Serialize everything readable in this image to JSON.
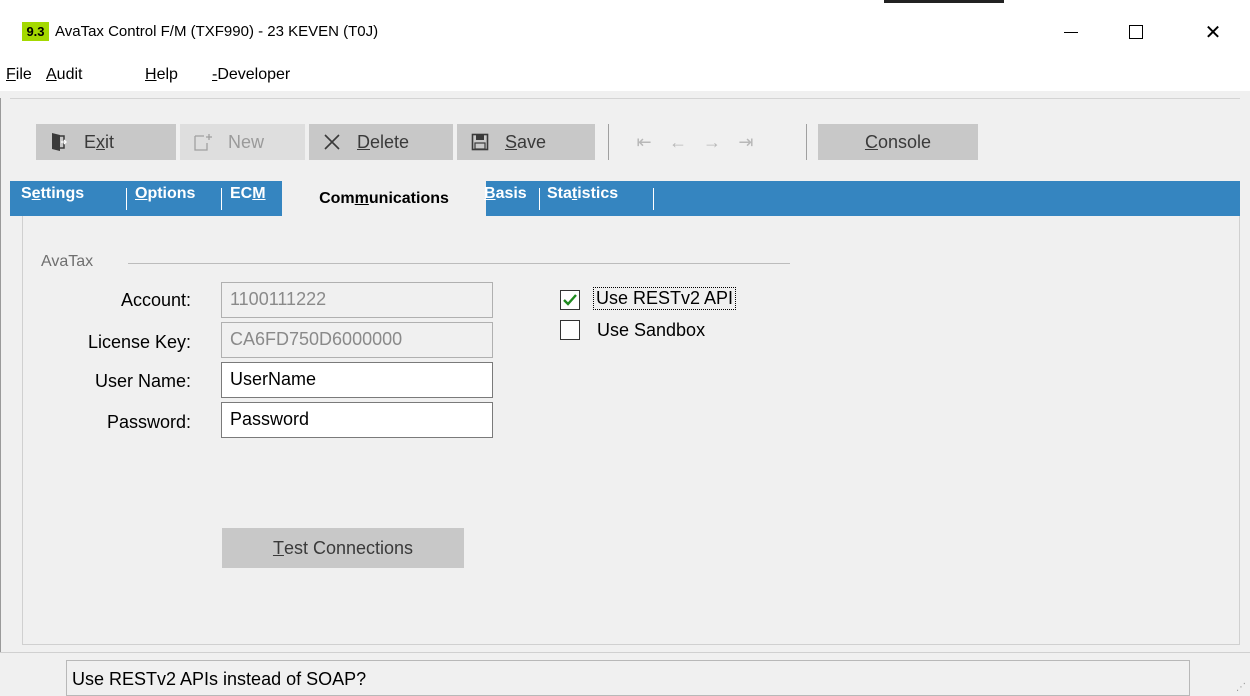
{
  "window": {
    "badge": "9.3",
    "title": "AvaTax Control F/M (TXF990) - 23 KEVEN (T0J)"
  },
  "menu": {
    "items": [
      {
        "underline": "F",
        "rest": "ile"
      },
      {
        "underline": "A",
        "rest": "udit"
      },
      {
        "underline": "H",
        "rest": "elp"
      },
      {
        "underline": "-",
        "rest": "Developer"
      }
    ]
  },
  "toolbar": {
    "exit": {
      "pre": "E",
      "underline": "x",
      "post": "it"
    },
    "new_label": "New",
    "delete": {
      "underline": "D",
      "post": "elete"
    },
    "save": {
      "underline": "S",
      "post": "ave"
    },
    "console": {
      "underline": "C",
      "post": "onsole"
    }
  },
  "tabs": {
    "settings": {
      "pre": "S",
      "underline": "e",
      "post": "ttings"
    },
    "options": {
      "underline": "O",
      "post": "ptions"
    },
    "ecm": {
      "pre": "EC",
      "underline": "M",
      "post": ""
    },
    "communications": {
      "pre": "Com",
      "underline": "m",
      "post": "unications"
    },
    "basis": {
      "underline": "B",
      "post": "asis"
    },
    "statistics": {
      "pre": "Sta",
      "underline": "t",
      "post": "istics"
    }
  },
  "form": {
    "group_title": "AvaTax",
    "account_label": "Account:",
    "account_value": "1100111222",
    "license_label": "License Key:",
    "license_value": "CA6FD750D6000000",
    "username_label": "User Name:",
    "username_value": "UserName",
    "password_label": "Password:",
    "password_value": "Password",
    "use_rest_label": "Use RESTv2 API",
    "use_rest_checked": true,
    "use_sandbox_label": "Use Sandbox",
    "use_sandbox_checked": false,
    "test_button": {
      "underline": "T",
      "post": "est Connections"
    }
  },
  "status": {
    "message": "Use RESTv2 APIs instead of SOAP?"
  }
}
